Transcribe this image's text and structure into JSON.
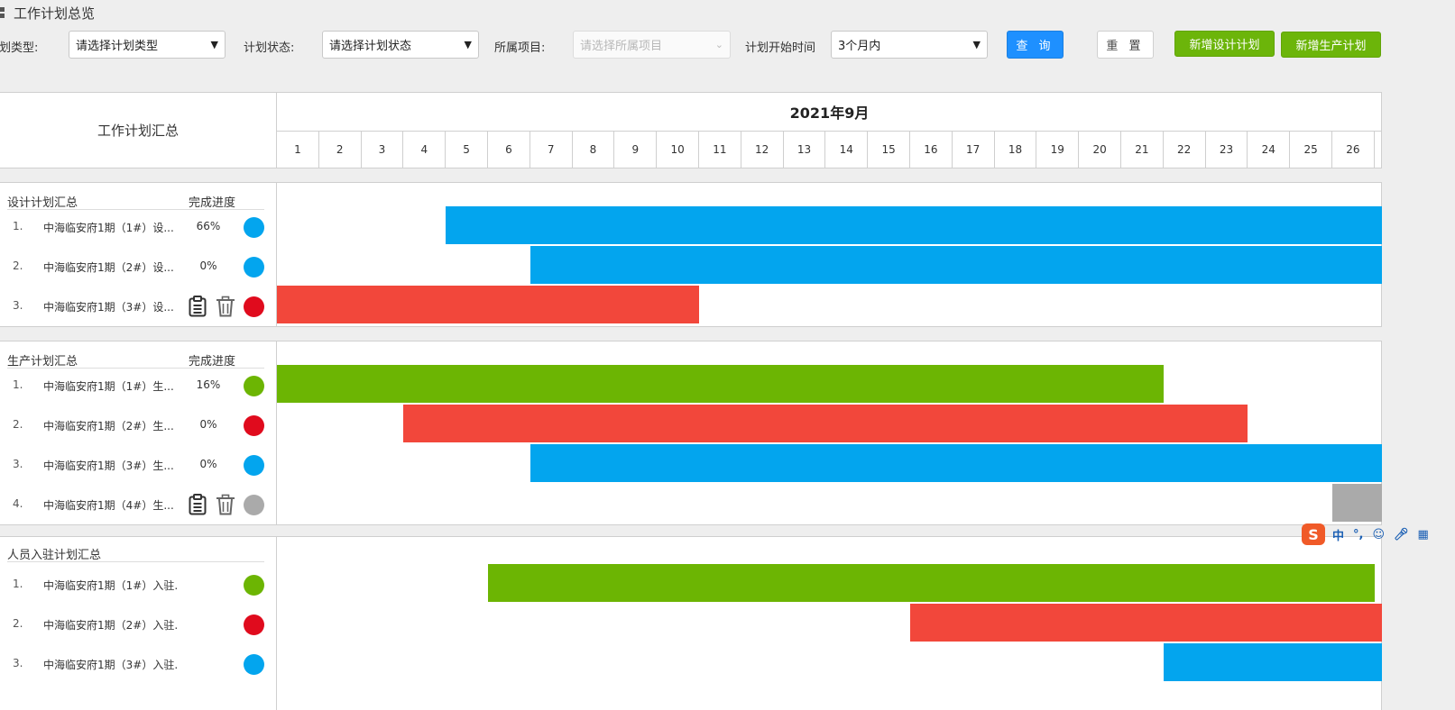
{
  "page": {
    "title": "工作计划总览"
  },
  "filters": {
    "type_label": "计划类型:",
    "type_value": "请选择计划类型",
    "status_label": "计划状态:",
    "status_value": "请选择计划状态",
    "project_label": "所属项目:",
    "project_placeholder": "请选择所属项目",
    "start_label": "计划开始时间",
    "start_value": "3个月内",
    "query_label": "查 询",
    "reset_label": "重 置",
    "add_design_label": "新增设计计划",
    "add_production_label": "新增生产计划"
  },
  "gantt": {
    "summary_title": "工作计划汇总",
    "month": "2021年9月",
    "days": [
      "1",
      "2",
      "3",
      "4",
      "5",
      "6",
      "7",
      "8",
      "9",
      "10",
      "11",
      "12",
      "13",
      "14",
      "15",
      "16",
      "17",
      "18",
      "19",
      "20",
      "21",
      "22",
      "23",
      "24",
      "25",
      "26"
    ],
    "sections": [
      {
        "title": "设计计划汇总",
        "progress_header": "完成进度",
        "rows": [
          {
            "idx": "1.",
            "name": "中海临安府1期（1#）设...",
            "pct": "66%",
            "status": "blue",
            "bar": {
              "start": 5,
              "end": 26.2,
              "color": "blue"
            }
          },
          {
            "idx": "2.",
            "name": "中海临安府1期（2#）设...",
            "pct": "0%",
            "status": "blue",
            "bar": {
              "start": 7,
              "end": 26.2,
              "color": "blue"
            }
          },
          {
            "idx": "3.",
            "name": "中海临安府1期（3#）设...",
            "pct": "",
            "actions": true,
            "status": "red",
            "bar": {
              "start": 1,
              "end": 10,
              "color": "red"
            }
          }
        ]
      },
      {
        "title": "生产计划汇总",
        "progress_header": "完成进度",
        "rows": [
          {
            "idx": "1.",
            "name": "中海临安府1期（1#）生...",
            "pct": "16%",
            "status": "green",
            "bar": {
              "start": 1,
              "end": 21,
              "color": "green"
            }
          },
          {
            "idx": "2.",
            "name": "中海临安府1期（2#）生...",
            "pct": "0%",
            "status": "red",
            "bar": {
              "start": 4,
              "end": 23,
              "color": "red"
            }
          },
          {
            "idx": "3.",
            "name": "中海临安府1期（3#）生...",
            "pct": "0%",
            "status": "blue",
            "bar": {
              "start": 7,
              "end": 26.2,
              "color": "blue"
            }
          },
          {
            "idx": "4.",
            "name": "中海临安府1期（4#）生...",
            "pct": "",
            "actions": true,
            "status": "gray",
            "bar": {
              "start": 26,
              "end": 26.2,
              "color": "gray"
            }
          }
        ]
      },
      {
        "title": "人员入驻计划汇总",
        "progress_header": "",
        "rows": [
          {
            "idx": "1.",
            "name": "中海临安府1期（1#）入驻...",
            "pct": "",
            "status": "green",
            "bar": {
              "start": 6,
              "end": 26,
              "color": "green"
            }
          },
          {
            "idx": "2.",
            "name": "中海临安府1期（2#）入驻...",
            "pct": "",
            "status": "red",
            "bar": {
              "start": 16,
              "end": 26.2,
              "color": "red"
            }
          },
          {
            "idx": "3.",
            "name": "中海临安府1期（3#）入驻...",
            "pct": "",
            "status": "blue",
            "bar": {
              "start": 22,
              "end": 26.2,
              "color": "blue"
            }
          }
        ]
      }
    ]
  },
  "colors": {
    "blue": "#03a5ee",
    "red": "#f2473b",
    "green": "#6cb503",
    "gray": "#aaaaaa",
    "dot_red": "#e00b1d",
    "primary": "#1e90ff"
  },
  "ime": {
    "label_cn": "中",
    "punct": "°,"
  }
}
